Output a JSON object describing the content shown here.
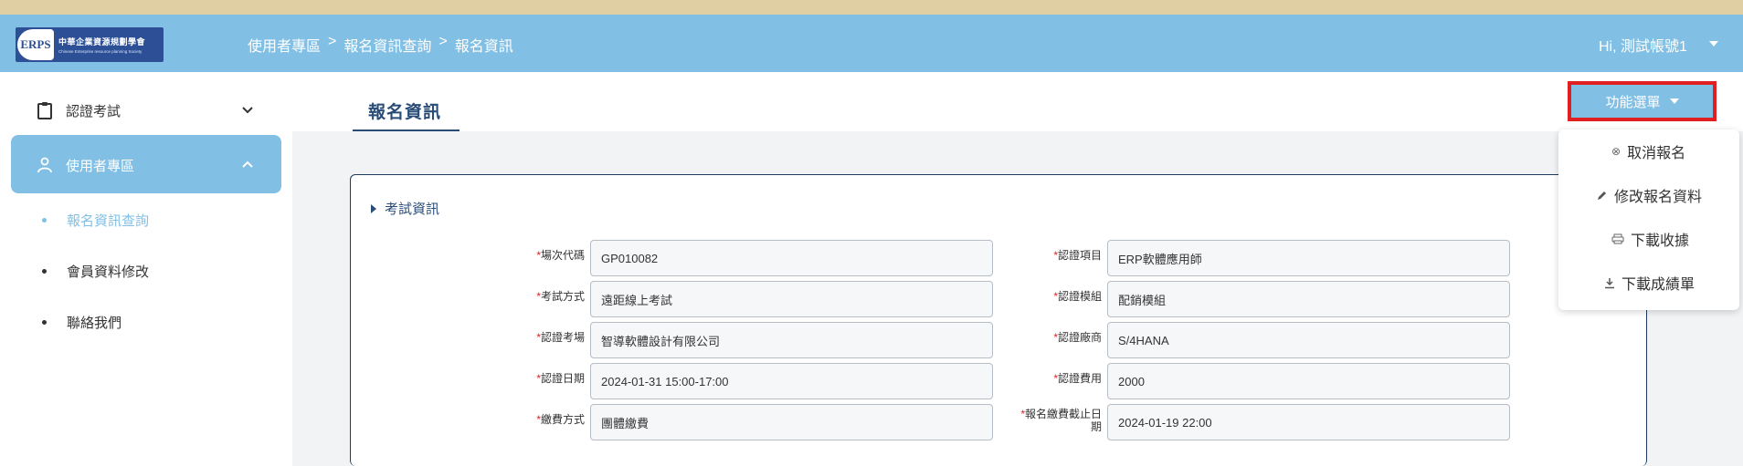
{
  "logo": {
    "mark": "ERPS",
    "title": "中華企業資源規劃學會",
    "subtitle": "Chinese Enterprise resource planning Society"
  },
  "header": {
    "breadcrumb": [
      "使用者專區",
      ">",
      "報名資訊查詢",
      ">",
      "報名資訊"
    ],
    "user_greeting": "Hi, 測試帳號1"
  },
  "sidebar": {
    "menu1": {
      "label": "認證考試",
      "icon": "clipboard-icon"
    },
    "menu2": {
      "label": "使用者專區",
      "icon": "user-icon"
    },
    "sub_items": [
      {
        "label": "報名資訊查詢",
        "active": true
      },
      {
        "label": "會員資料修改",
        "active": false
      },
      {
        "label": "聯絡我們",
        "active": false
      }
    ]
  },
  "page": {
    "title": "報名資訊"
  },
  "function_menu": {
    "button_label": "功能選單",
    "items": [
      {
        "label": "取消報名",
        "icon": "cancel-circle-icon"
      },
      {
        "label": "修改報名資料",
        "icon": "pencil-icon"
      },
      {
        "label": "下載收據",
        "icon": "printer-icon"
      },
      {
        "label": "下載成績單",
        "icon": "download-icon"
      }
    ]
  },
  "exam_info": {
    "section_title": "考試資訊",
    "left_fields": [
      {
        "label": "場次代碼",
        "value": "GP010082"
      },
      {
        "label": "考試方式",
        "value": "遠距線上考試"
      },
      {
        "label": "認證考場",
        "value": "智導軟體設計有限公司"
      },
      {
        "label": "認證日期",
        "value": "2024-01-31 15:00-17:00"
      },
      {
        "label": "繳費方式",
        "value": "團體繳費"
      }
    ],
    "right_fields": [
      {
        "label": "認證項目",
        "value": "ERP軟體應用師"
      },
      {
        "label": "認證模組",
        "value": "配銷模組"
      },
      {
        "label": "認證廠商",
        "value": "S/4HANA"
      },
      {
        "label": "認證費用",
        "value": "2000"
      },
      {
        "label_line1": "報名繳費截止日",
        "label_line2": "期",
        "value": "2024-01-19 22:00"
      }
    ],
    "required_mark": "*"
  },
  "colors": {
    "header": "#81bfe4",
    "top_strip": "#e0cfa3",
    "title": "#2a4d78",
    "highlight_border": "#e02020"
  }
}
